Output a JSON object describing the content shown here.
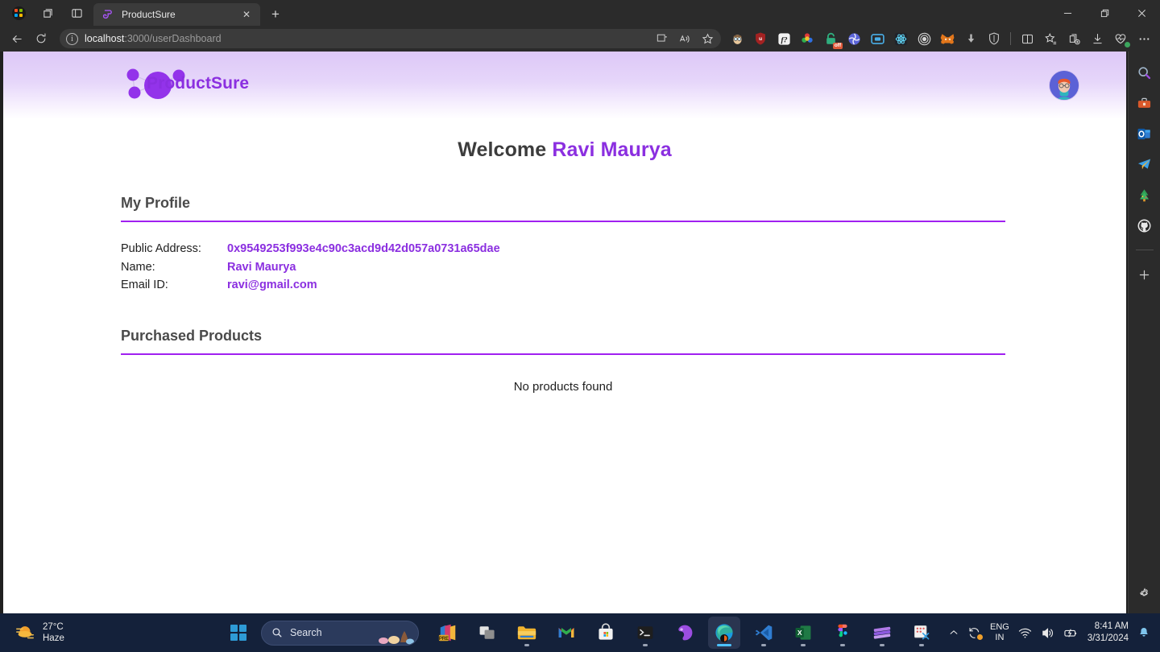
{
  "browser": {
    "tab": {
      "title": "ProductSure",
      "favicon": "spiral-purple-icon",
      "close_label": "✕"
    },
    "new_tab_label": "+",
    "window_controls": {
      "minimize": "—",
      "restore": "❐",
      "close": "✕"
    },
    "nav": {
      "back": "←",
      "refresh": "⟳"
    },
    "omnibox": {
      "info_glyph": "i",
      "url_host": "localhost",
      "url_path": ":3000/userDashboard",
      "full_url": "localhost:3000/userDashboard",
      "split_screen": "split-screen-icon",
      "read_aloud": "read-aloud-icon",
      "favorite": "star-icon"
    },
    "extensions": [
      {
        "name": "profile-face-extension-icon",
        "glyph": "👤"
      },
      {
        "name": "ublock-origin-extension-icon",
        "glyph": "🛡"
      },
      {
        "name": "formula-extension-icon",
        "glyph": "f?"
      },
      {
        "name": "color-picker-extension-icon",
        "glyph": "❀"
      },
      {
        "name": "vpn-off-extension-icon",
        "glyph": "🔒",
        "badge": "off"
      },
      {
        "name": "spiral-blue-extension-icon",
        "glyph": "◎"
      },
      {
        "name": "screen-recorder-extension-icon",
        "glyph": "▣"
      },
      {
        "name": "react-devtools-extension-icon",
        "glyph": "⚛"
      },
      {
        "name": "target-extension-icon",
        "glyph": "◎"
      },
      {
        "name": "metamask-extension-icon",
        "glyph": "🦊"
      },
      {
        "name": "download-helper-extension-icon",
        "glyph": "⬇"
      },
      {
        "name": "shield-extension-icon",
        "glyph": "🛡"
      }
    ],
    "toolbar_right": [
      {
        "name": "split-screen-icon",
        "glyph": "◫"
      },
      {
        "name": "favorites-icon",
        "glyph": "☆"
      },
      {
        "name": "collections-icon",
        "glyph": "⧉"
      },
      {
        "name": "downloads-icon",
        "glyph": "⬇"
      },
      {
        "name": "browser-essentials-icon",
        "glyph": "♡"
      },
      {
        "name": "settings-and-more-icon",
        "glyph": "⋯"
      }
    ],
    "sidebar": [
      {
        "name": "search-icon",
        "glyph": "🔍"
      },
      {
        "name": "tools-icon",
        "glyph": "🧰"
      },
      {
        "name": "outlook-icon",
        "glyph": "✉"
      },
      {
        "name": "telegram-icon",
        "glyph": "✈"
      },
      {
        "name": "games-tree-icon",
        "glyph": "🎄"
      },
      {
        "name": "github-icon",
        "glyph": "●"
      },
      {
        "name": "add-sidebar-app-icon",
        "glyph": "+"
      }
    ],
    "sidebar_settings": {
      "name": "sidebar-settings-icon",
      "glyph": "⚙"
    }
  },
  "page": {
    "logo": {
      "text": "ProductSure",
      "color": "#8b2fe0"
    },
    "avatar_alt": "user-avatar",
    "welcome": {
      "prefix": "Welcome",
      "user_name": "Ravi Maurya"
    },
    "profile": {
      "heading": "My Profile",
      "fields": [
        {
          "label": "Public Address:",
          "value": "0x9549253f993e4c90c3acd9d42d057a0731a65dae"
        },
        {
          "label": "Name:",
          "value": "Ravi Maurya"
        },
        {
          "label": "Email ID:",
          "value": "ravi@gmail.com"
        }
      ]
    },
    "products": {
      "heading": "Purchased Products",
      "empty_message": "No products found"
    },
    "accent_color": "#8b2fe0",
    "rule_color": "#a020f0"
  },
  "taskbar": {
    "weather": {
      "temperature": "27°C",
      "condition": "Haze"
    },
    "start_label": "start-button",
    "search": {
      "placeholder": "Search",
      "icon": "search-icon"
    },
    "apps": [
      {
        "name": "office-pre-taskbar-icon",
        "running": false
      },
      {
        "name": "task-view-taskbar-icon",
        "running": false
      },
      {
        "name": "file-explorer-taskbar-icon",
        "running": true
      },
      {
        "name": "gmail-taskbar-icon",
        "running": false
      },
      {
        "name": "microsoft-store-taskbar-icon",
        "running": false
      },
      {
        "name": "terminal-taskbar-icon",
        "running": true
      },
      {
        "name": "phone-link-taskbar-icon",
        "running": false
      },
      {
        "name": "edge-taskbar-icon",
        "running": true,
        "active": true
      },
      {
        "name": "vscode-taskbar-icon",
        "running": true
      },
      {
        "name": "excel-taskbar-icon",
        "running": true
      },
      {
        "name": "figma-taskbar-icon",
        "running": true
      },
      {
        "name": "video-editor-taskbar-icon",
        "running": true
      },
      {
        "name": "snipping-tool-taskbar-icon",
        "running": true
      }
    ],
    "tray": {
      "show_hidden": "∧",
      "update_icon": "update-available-icon",
      "language": {
        "line1": "ENG",
        "line2": "IN"
      },
      "network": "wifi-icon",
      "volume": "volume-icon",
      "battery": "battery-icon",
      "time": "8:41 AM",
      "date": "3/31/2024",
      "notifications": "notification-bell-icon"
    }
  }
}
